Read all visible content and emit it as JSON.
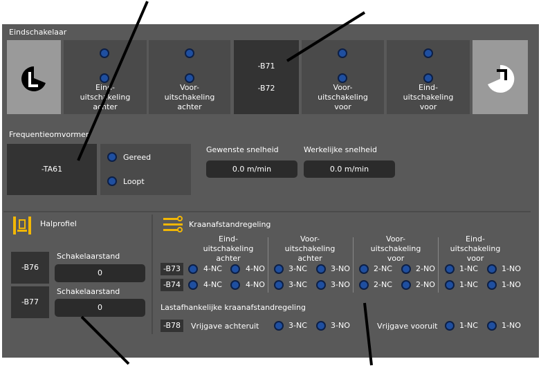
{
  "eindschakelaar": {
    "title": "Eindschakelaar",
    "tiles": [
      {
        "label": "Eind-\nuitschakeling\nachter"
      },
      {
        "label": "Voor-\nuitschakeling\nachter"
      },
      {
        "label1": "-B71",
        "label2": "-B72"
      },
      {
        "label": "Voor-\nuitschakeling\nvoor"
      },
      {
        "label": "Eind-\nuitschakeling\nvoor"
      }
    ]
  },
  "frequentie": {
    "title": "Frequentieomvormer",
    "device": "-TA61",
    "status_ready": "Gereed",
    "status_running": "Loopt",
    "desired_label": "Gewenste snelheid",
    "desired_value": "0.0 m/min",
    "actual_label": "Werkelijke snelheid",
    "actual_value": "0.0 m/min"
  },
  "halprofiel": {
    "title": "Halprofiel",
    "rows": [
      {
        "tag": "-B76",
        "label": "Schakelaarstand",
        "value": "0"
      },
      {
        "tag": "-B77",
        "label": "Schakelaarstand",
        "value": "0"
      }
    ]
  },
  "kraan": {
    "title": "Kraanafstandregeling",
    "columns": [
      "Eind-\nuitschakeling\nachter",
      "Voor-\nuitschakeling\nachter",
      "Voor-\nuitschakeling\nvoor",
      "Eind-\nuitschakeling\nvoor"
    ],
    "rows": [
      {
        "tag": "-B73",
        "contacts": [
          "4-NC",
          "4-NO",
          "3-NC",
          "3-NO",
          "2-NC",
          "2-NO",
          "1-NC",
          "1-NO"
        ]
      },
      {
        "tag": "-B74",
        "contacts": [
          "4-NC",
          "4-NO",
          "3-NC",
          "3-NO",
          "2-NC",
          "2-NO",
          "1-NC",
          "1-NO"
        ]
      }
    ],
    "last_title": "Lastafhankelijke kraanafstandregeling",
    "last_tag": "-B78",
    "reverse_label": "Vrijgave achteruit",
    "reverse_nc": "3-NC",
    "reverse_no": "3-NO",
    "forward_label": "Vrijgave vooruit",
    "forward_nc": "1-NC",
    "forward_no": "1-NO"
  },
  "colors": {
    "led": "#1f4fa0",
    "panel": "#595959",
    "tile": "#4a4a4a",
    "accent": "#f2b705"
  }
}
